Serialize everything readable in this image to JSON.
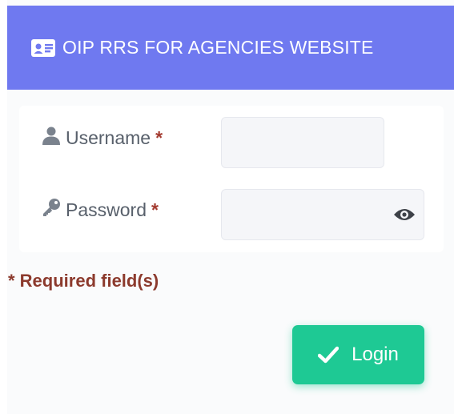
{
  "header": {
    "title": "OIP RRS FOR AGENCIES WEBSITE",
    "icon": "id-card-icon",
    "background_color": "#6f79f0"
  },
  "form": {
    "username": {
      "label": "Username",
      "required_marker": "*",
      "icon": "user-icon",
      "value": ""
    },
    "password": {
      "label": "Password",
      "required_marker": "*",
      "icon": "key-icon",
      "value": "",
      "toggle_icon": "eye-icon"
    }
  },
  "required_note": "* Required field(s)",
  "login_button": {
    "label": "Login",
    "icon": "check-icon",
    "color": "#1ec994"
  },
  "colors": {
    "required": "#8c3a2d",
    "label": "#58606b"
  }
}
